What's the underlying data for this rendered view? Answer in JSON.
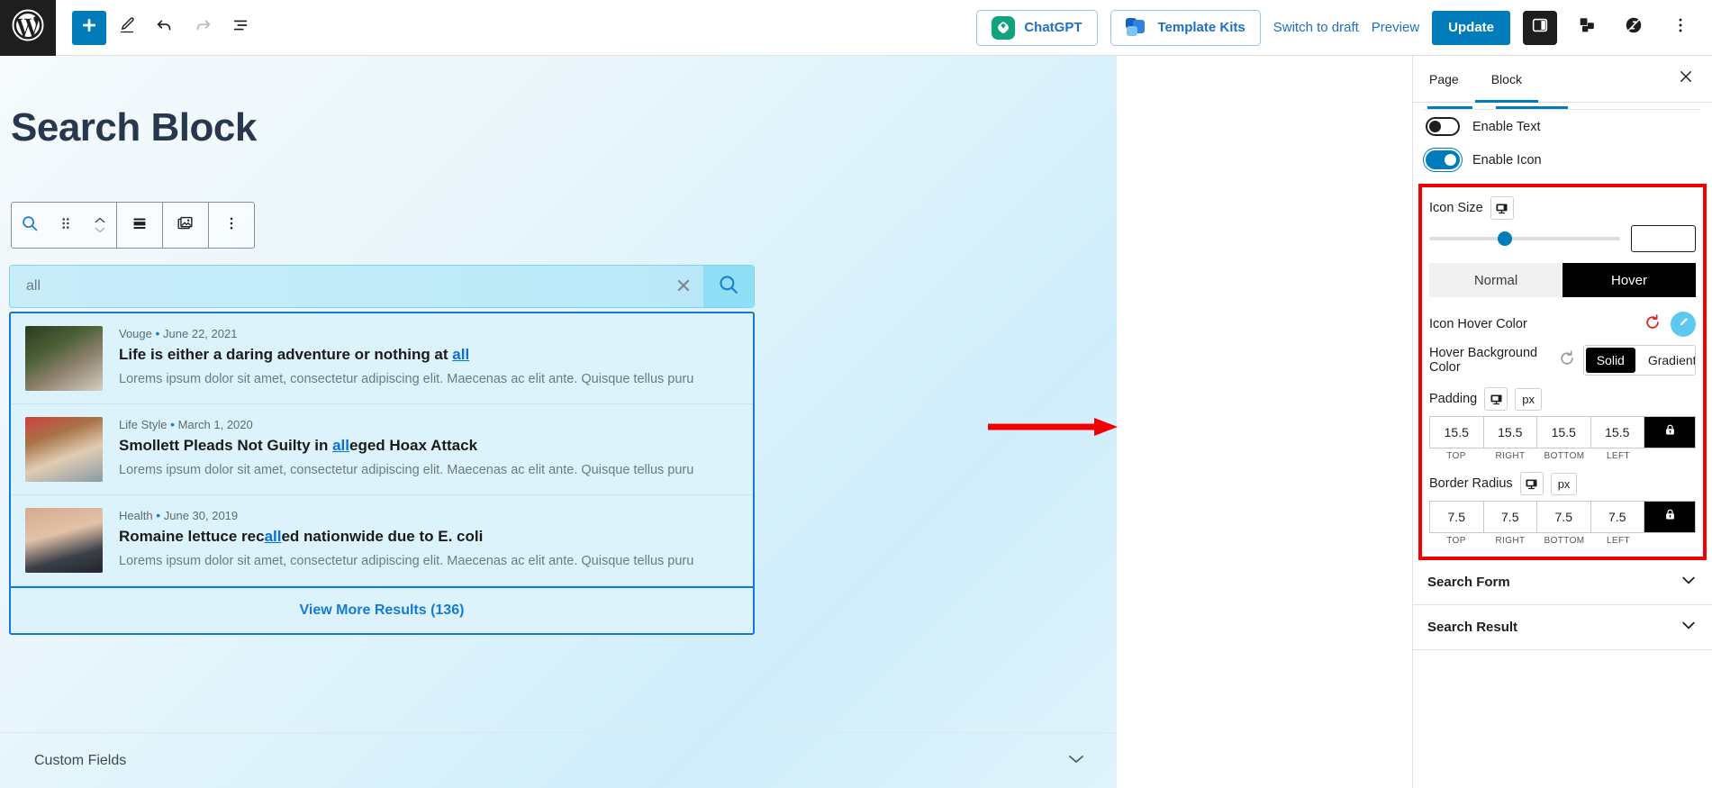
{
  "topbar": {
    "logo_icon": "wordpress-logo-icon",
    "add_block_label": "+",
    "tools": [
      {
        "name": "add-block-button",
        "icon": "plus-icon"
      },
      {
        "name": "edit-tool-button",
        "icon": "pencil-icon"
      },
      {
        "name": "undo-button",
        "icon": "undo-arrow-icon"
      },
      {
        "name": "redo-button",
        "icon": "redo-arrow-icon"
      },
      {
        "name": "document-overview-button",
        "icon": "list-view-icon"
      }
    ],
    "chatgpt_label": "ChatGPT",
    "template_kits_label": "Template Kits",
    "switch_to_draft_label": "Switch to draft",
    "preview_label": "Preview",
    "update_label": "Update",
    "settings_panel_label": "settings-sidebar-icon",
    "template_icon_label": "template-blocks-icon",
    "plugin_icon_label": "plugin-badge-icon",
    "more_options_label": "three-dots-vertical-icon"
  },
  "canvas": {
    "page_title": "Search Block",
    "block_toolbar": {
      "block_type_icon": "search-magnifier-icon",
      "drag_handle_icon": "drag-dots-icon",
      "move_up_icon": "chevron-up-icon",
      "move_down_icon": "chevron-down-icon",
      "layout_icon": "block-layout-icon",
      "media_icon": "image-stack-icon",
      "more_icon": "three-dots-vertical-icon"
    },
    "search_form": {
      "value": "all",
      "clear_icon": "clear-x-icon",
      "submit_icon": "search-magnifier-icon"
    },
    "results": [
      {
        "category": "Vouge",
        "date": "June 22, 2021",
        "title_before": "Life is either a daring adventure or nothing at ",
        "title_highlight": "all",
        "title_after": "",
        "excerpt": "Lorems ipsum dolor sit amet, consectetur adipiscing elit. Maecenas ac elit ante. Quisque tellus puru"
      },
      {
        "category": "Life Style",
        "date": "March 1, 2020",
        "title_before": "Smollett Pleads Not Guilty in ",
        "title_highlight": "all",
        "title_after": "eged Hoax Attack",
        "excerpt": "Lorems ipsum dolor sit amet, consectetur adipiscing elit. Maecenas ac elit ante. Quisque tellus puru"
      },
      {
        "category": "Health",
        "date": "June 30, 2019",
        "title_before": "Romaine lettuce rec",
        "title_highlight": "all",
        "title_after": "ed nationwide due to E. coli",
        "excerpt": "Lorems ipsum dolor sit amet, consectetur adipiscing elit. Maecenas ac elit ante. Quisque tellus puru"
      }
    ],
    "view_more_label": "View More Results (136)",
    "custom_fields_label": "Custom Fields",
    "custom_fields_caret": "caret-down-icon"
  },
  "sidebar": {
    "tabs": [
      {
        "label": "Page",
        "active": false
      },
      {
        "label": "Block",
        "active": true
      }
    ],
    "close_icon": "close-x-icon",
    "toggles": [
      {
        "label": "Enable Text",
        "state": "off"
      },
      {
        "label": "Enable Icon",
        "state": "on"
      }
    ],
    "icon_size": {
      "label": "Icon Size",
      "device_icon": "desktop-responsive-icon",
      "value": "",
      "slider_percent": 36
    },
    "state_tabs": {
      "normal_label": "Normal",
      "hover_label": "Hover",
      "active": "Hover"
    },
    "icon_hover_color": {
      "label": "Icon Hover Color",
      "reset_icon": "reset-circular-arrow-icon",
      "swatch_icon": "color-brush-icon",
      "swatch_color": "#5ec9f0"
    },
    "hover_background_color": {
      "label": "Hover Background Color",
      "reset_icon": "reset-circular-arrow-icon",
      "solid_label": "Solid",
      "gradient_label": "Gradient",
      "active": "Solid"
    },
    "padding": {
      "label": "Padding",
      "device_icon": "desktop-responsive-icon",
      "unit": "px",
      "values": [
        "15.5",
        "15.5",
        "15.5",
        "15.5"
      ],
      "side_labels": [
        "TOP",
        "RIGHT",
        "BOTTOM",
        "LEFT"
      ],
      "lock_icon": "lock-closed-icon"
    },
    "border_radius": {
      "label": "Border Radius",
      "device_icon": "desktop-responsive-icon",
      "unit": "px",
      "values": [
        "7.5",
        "7.5",
        "7.5",
        "7.5"
      ],
      "side_labels": [
        "TOP",
        "RIGHT",
        "BOTTOM",
        "LEFT"
      ],
      "lock_icon": "lock-closed-icon"
    },
    "accordions": [
      {
        "title": "Search Form",
        "caret": "chevron-down-icon"
      },
      {
        "title": "Search Result",
        "caret": "chevron-down-icon"
      }
    ]
  },
  "annotation": {
    "arrow_color": "#f40000",
    "highlight_box_color": "#f40000"
  }
}
